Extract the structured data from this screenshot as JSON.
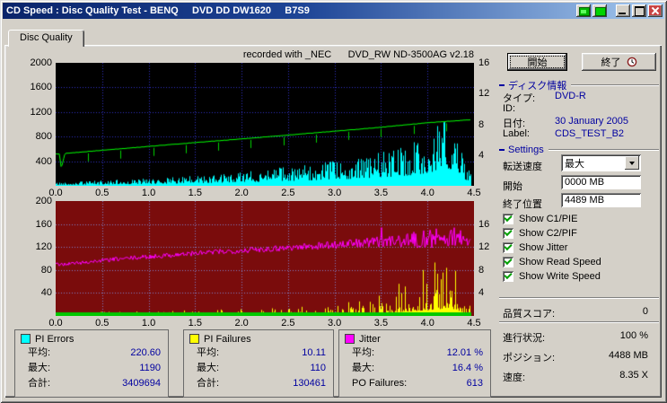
{
  "window": {
    "title": "CD Speed : Disc Quality Test - BENQ     DVD DD DW1620     B7S9"
  },
  "tab": {
    "label": "Disc Quality"
  },
  "top_note": "recorded with _NEC      DVD_RW ND-3500AG v2.18",
  "buttons": {
    "start": "開始",
    "exit": "終了"
  },
  "disc_info": {
    "header": "ディスク情報",
    "type_label": "タイプ:",
    "type": "DVD-R",
    "id_label": "ID:",
    "id": "",
    "date_label": "日付:",
    "date": "30 January 2005",
    "label_label": "Label:",
    "label": "CDS_TEST_B2"
  },
  "settings": {
    "header": "Settings",
    "speed_label": "転送速度",
    "speed_value": "最大",
    "start_label": "開始",
    "start_value": "0000 MB",
    "end_label": "終了位置",
    "end_value": "4489 MB",
    "checkboxes": [
      {
        "label": "Show C1/PIE",
        "checked": true
      },
      {
        "label": "Show C2/PIF",
        "checked": true
      },
      {
        "label": "Show Jitter",
        "checked": true
      },
      {
        "label": "Show Read Speed",
        "checked": true
      },
      {
        "label": "Show Write Speed",
        "checked": true
      }
    ]
  },
  "quality": {
    "label": "品質スコア:",
    "value": "0"
  },
  "progress": {
    "label": "進行状況:",
    "value": "100 %",
    "position_label": "ポジション:",
    "position": "4488 MB",
    "speed_label": "速度:",
    "speed": "8.35 X"
  },
  "legend": {
    "pi_errors": {
      "title": "PI Errors",
      "color": "#00ffff",
      "rows": [
        [
          "平均:",
          "220.60"
        ],
        [
          "最大:",
          "1190"
        ],
        [
          "合計:",
          "3409694"
        ]
      ]
    },
    "pi_failures": {
      "title": "PI Failures",
      "color": "#ffff00",
      "rows": [
        [
          "平均:",
          "10.11"
        ],
        [
          "最大:",
          "110"
        ],
        [
          "合計:",
          "130461"
        ]
      ]
    },
    "jitter": {
      "title": "Jitter",
      "color": "#ff00ff",
      "rows": [
        [
          "平均:",
          "12.01 %"
        ],
        [
          "最大:",
          "16.4 %"
        ],
        [
          "PO Failures:",
          "613"
        ]
      ]
    }
  },
  "chart_data": [
    {
      "type": "area",
      "title": "PI Errors / Read Speed",
      "bg": "#000000",
      "grid_color": "#3030c8",
      "grid": true,
      "x_max": 4.5,
      "x_end": 4.47,
      "x_ticks": [
        "0.0",
        "0.5",
        "1.0",
        "1.5",
        "2.0",
        "2.5",
        "3.0",
        "3.5",
        "4.0",
        "4.5"
      ],
      "y_left_max": 2000,
      "y_left_ticks": [
        "2000",
        "1600",
        "1200",
        "800",
        "400"
      ],
      "y_right_max": 16,
      "y_right_ticks": [
        "16",
        "12",
        "8",
        "4"
      ],
      "series": [
        {
          "name": "PI Errors",
          "color": "#00ffff",
          "style": "spikes",
          "points": [
            [
              0,
              60
            ],
            [
              0.3,
              75
            ],
            [
              0.6,
              95
            ],
            [
              0.9,
              115
            ],
            [
              1.2,
              140
            ],
            [
              1.5,
              170
            ],
            [
              1.8,
              205
            ],
            [
              2.1,
              245
            ],
            [
              2.4,
              295
            ],
            [
              2.7,
              350
            ],
            [
              3.0,
              410
            ],
            [
              3.3,
              480
            ],
            [
              3.6,
              580
            ],
            [
              3.8,
              680
            ],
            [
              4.0,
              820
            ],
            [
              4.1,
              980
            ],
            [
              4.2,
              1150
            ],
            [
              4.28,
              1020
            ],
            [
              4.35,
              600
            ],
            [
              4.45,
              250
            ]
          ]
        },
        {
          "name": "Read Speed",
          "color": "#00ff00",
          "style": "line",
          "unit": "x",
          "points": [
            [
              0,
              4.15
            ],
            [
              0.04,
              4.15
            ],
            [
              0.06,
              2.3
            ],
            [
              0.1,
              4.2
            ],
            [
              0.5,
              4.62
            ],
            [
              1.0,
              5.12
            ],
            [
              1.5,
              5.62
            ],
            [
              2.0,
              6.1
            ],
            [
              2.5,
              6.6
            ],
            [
              3.0,
              7.1
            ],
            [
              3.5,
              7.62
            ],
            [
              4.0,
              8.2
            ],
            [
              4.47,
              8.6
            ]
          ]
        }
      ]
    },
    {
      "type": "area",
      "title": "PI Failures / Jitter",
      "bg": "#7a0c0c",
      "grid_color": "#8080c8",
      "grid": true,
      "x_max": 4.5,
      "x_end": 4.47,
      "x_ticks": [
        "0.0",
        "0.5",
        "1.0",
        "1.5",
        "2.0",
        "2.5",
        "3.0",
        "3.5",
        "4.0",
        "4.5"
      ],
      "y_left_max": 200,
      "y_left_ticks": [
        "200",
        "160",
        "120",
        "80",
        "40"
      ],
      "y_right_max": 16,
      "y_right_ticks": [
        "16",
        "12",
        "8",
        "4"
      ],
      "bottom_strip_color": "#00c800",
      "series": [
        {
          "name": "PI Failures",
          "color": "#ffff00",
          "style": "spikes",
          "points": [
            [
              0,
              6
            ],
            [
              0.5,
              7
            ],
            [
              1.0,
              8
            ],
            [
              1.5,
              10
            ],
            [
              2.0,
              12
            ],
            [
              2.5,
              15
            ],
            [
              3.0,
              20
            ],
            [
              3.3,
              28
            ],
            [
              3.5,
              38
            ],
            [
              3.7,
              58
            ],
            [
              3.9,
              75
            ],
            [
              4.05,
              90
            ],
            [
              4.2,
              108
            ],
            [
              4.3,
              92
            ],
            [
              4.4,
              45
            ],
            [
              4.47,
              12
            ]
          ]
        },
        {
          "name": "Jitter",
          "color": "#ff00ff",
          "style": "noisy-line",
          "unit": "%",
          "max_value": 16.4,
          "points": [
            [
              0,
              8.9
            ],
            [
              0.3,
              9.3
            ],
            [
              0.6,
              9.8
            ],
            [
              1.0,
              10.3
            ],
            [
              1.5,
              10.9
            ],
            [
              2.0,
              11.4
            ],
            [
              2.5,
              11.9
            ],
            [
              3.0,
              12.4
            ],
            [
              3.5,
              12.9
            ],
            [
              3.9,
              13.3
            ],
            [
              4.1,
              13.5
            ],
            [
              4.3,
              13.6
            ],
            [
              4.47,
              12.8
            ]
          ],
          "noise_amp": [
            [
              0,
              0.3
            ],
            [
              2.0,
              0.5
            ],
            [
              3.0,
              0.7
            ],
            [
              3.6,
              1.0
            ],
            [
              4.0,
              1.6
            ],
            [
              4.3,
              2.0
            ],
            [
              4.47,
              1.0
            ]
          ]
        }
      ]
    }
  ]
}
